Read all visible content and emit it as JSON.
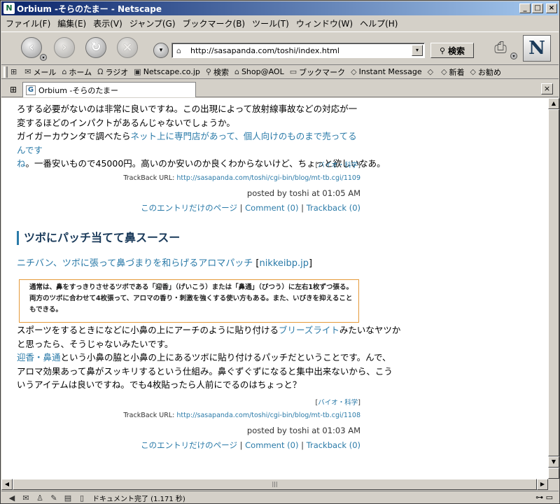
{
  "window": {
    "title": "Orbium -そらのたまー - Netscape",
    "app_icon": "netscape-logo-icon"
  },
  "menu": [
    "ファイル(F)",
    "編集(E)",
    "表示(V)",
    "ジャンプ(G)",
    "ブックマーク(B)",
    "ツール(T)",
    "ウィンドウ(W)",
    "ヘルプ(H)"
  ],
  "navigation": {
    "url": "http://sasapanda.com/toshi/index.html",
    "search_label": "検索"
  },
  "personal_toolbar": {
    "items": [
      {
        "label": "メール",
        "icon": "mail-icon"
      },
      {
        "label": "ホーム",
        "icon": "home-icon"
      },
      {
        "label": "ラジオ",
        "icon": "headphones-icon"
      },
      {
        "label": "Netscape.co.jp",
        "icon": "my-netscape-icon"
      },
      {
        "label": "検索",
        "icon": "search-icon"
      },
      {
        "label": "Shop@AOL",
        "icon": "shop-icon"
      },
      {
        "label": "ブックマーク",
        "icon": "bookmark-folder-icon"
      },
      {
        "label": "Instant Message",
        "icon": "instant-message-icon"
      },
      {
        "label": "",
        "icon": "bookmark-icon"
      },
      {
        "label": "新着",
        "icon": "bookmark-icon"
      },
      {
        "label": "お勧め",
        "icon": "bookmark-icon"
      }
    ]
  },
  "tab": {
    "title": "Orbium -そらのたまー"
  },
  "content": {
    "post1": {
      "line1": "ろする必要がないのは非常に良いですね。この出現によって放射線事故などの対応が一",
      "line2": "変するほどのインパクトがあるんじゃないでしょうか。",
      "line3_pre": "ガイガーカウンタで調べたら",
      "link_text": "ネット上に専門店があって、個人向けのものまで売ってるんです",
      "link_text2": "ね",
      "line4_post": "。一番安いもので45000円。高いのか安いのか良くわからないけど、ちょっと欲しいなあ。",
      "category": "バイオ・科学",
      "trackback_label": "TrackBack URL:",
      "trackback_url": "http://sasapanda.com/toshi/cgi-bin/blog/mt-tb.cgi/1109",
      "posted": "posted by toshi at 01:05 AM",
      "entry_page": "このエントリだけのページ",
      "comment": "Comment (0)",
      "trackback": "Trackback (0)"
    },
    "post2": {
      "title": "ツボにパッチ当てて鼻スースー",
      "source_link": "ニチバン、ツボに張って鼻づまりを和らげるアロマパッチ",
      "source_site": "nikkeibp.jp",
      "quote": "通常は、鼻をすっきりさせるツボである「迎香」（げいこう）または「鼻通」（びつう）に左右1枚ずつ張る。両方のツボに合わせて4枚張って、アロマの香り・刺激を強くする使い方もある。また、いびきを抑えることもできる。",
      "p1_pre": "スポーツをするときになどに小鼻の上にアーチのように貼り付ける",
      "p1_link": "ブリーズライト",
      "p1_post": "みたいなヤツか",
      "p1_line2": "と思ったら、そうじゃないみたいです。",
      "p2_link": "迎香・鼻通",
      "p2_text1": "という小鼻の脇と小鼻の上にあるツボに貼り付けるパッチだということです。んで、",
      "p2_text2": "アロマ効果あって鼻がスッキリするという仕組み。鼻ぐずぐずになると集中出来ないから、こう",
      "p2_text3": "いうアイテムは良いですね。でも4枚貼ったら人前にでるのはちょっと？",
      "category": "バイオ・科学",
      "trackback_label": "TrackBack URL:",
      "trackback_url": "http://sasapanda.com/toshi/cgi-bin/blog/mt-tb.cgi/1108",
      "posted": "posted by toshi at 01:03 AM",
      "entry_page": "このエントリだけのページ",
      "comment": "Comment (0)",
      "trackback": "Trackback (0)"
    }
  },
  "status": {
    "text": "ドキュメント完了 (1.171 秒)"
  },
  "colors": {
    "link": "#2a7aa8",
    "heading": "#1a3a5a",
    "quote_border": "#e59a3a",
    "titlebar_start": "#0a246a"
  }
}
